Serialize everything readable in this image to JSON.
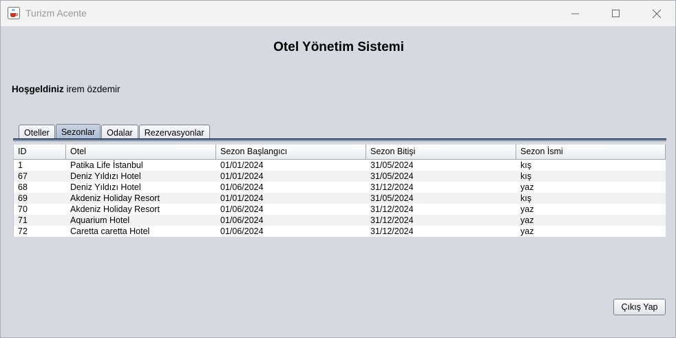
{
  "window": {
    "title": "Turizm Acente",
    "icon": "java-cup-icon"
  },
  "header": {
    "title": "Otel Yönetim Sistemi"
  },
  "welcome": {
    "label": "Hoşgeldiniz",
    "user": "irem özdemir"
  },
  "tabs": [
    {
      "label": "Oteller",
      "active": false
    },
    {
      "label": "Sezonlar",
      "active": true
    },
    {
      "label": "Odalar",
      "active": false
    },
    {
      "label": "Rezervasyonlar",
      "active": false
    }
  ],
  "table": {
    "columns": [
      "ID",
      "Otel",
      "Sezon Başlangıcı",
      "Sezon Bitişi",
      "Sezon İsmi"
    ],
    "rows": [
      [
        "1",
        "Patika Life İstanbul",
        "01/01/2024",
        "31/05/2024",
        "kış"
      ],
      [
        "67",
        "Deniz Yıldızı Hotel",
        "01/01/2024",
        "31/05/2024",
        "kış"
      ],
      [
        "68",
        "Deniz Yıldızı Hotel",
        "01/06/2024",
        "31/12/2024",
        "yaz"
      ],
      [
        "69",
        "Akdeniz Holiday Resort",
        "01/01/2024",
        "31/05/2024",
        "kış"
      ],
      [
        "70",
        "Akdeniz Holiday Resort",
        "01/06/2024",
        "31/12/2024",
        "yaz"
      ],
      [
        "71",
        "Aquarium Hotel",
        "01/06/2024",
        "31/12/2024",
        "yaz"
      ],
      [
        "72",
        "Caretta caretta Hotel",
        "01/06/2024",
        "31/12/2024",
        "yaz"
      ]
    ]
  },
  "footer": {
    "exit_label": "Çıkış Yap"
  }
}
